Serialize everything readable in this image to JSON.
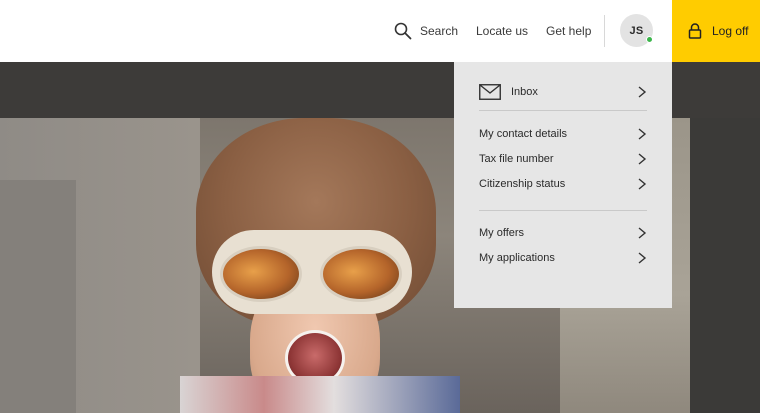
{
  "header": {
    "search_label": "Search",
    "locate_label": "Locate us",
    "help_label": "Get help",
    "avatar_initials": "JS",
    "logoff_label": "Log off"
  },
  "menu": {
    "inbox": "Inbox",
    "contact_details": "My contact details",
    "tax_file_number": "Tax file number",
    "citizenship_status": "Citizenship status",
    "offers": "My offers",
    "applications": "My applications"
  },
  "colors": {
    "accent": "#ffcc00",
    "online": "#3ab54a",
    "menu_bg": "#e6e6e6"
  },
  "icons": [
    "search-icon",
    "lock-icon",
    "envelope-icon",
    "chevron-right-icon"
  ]
}
